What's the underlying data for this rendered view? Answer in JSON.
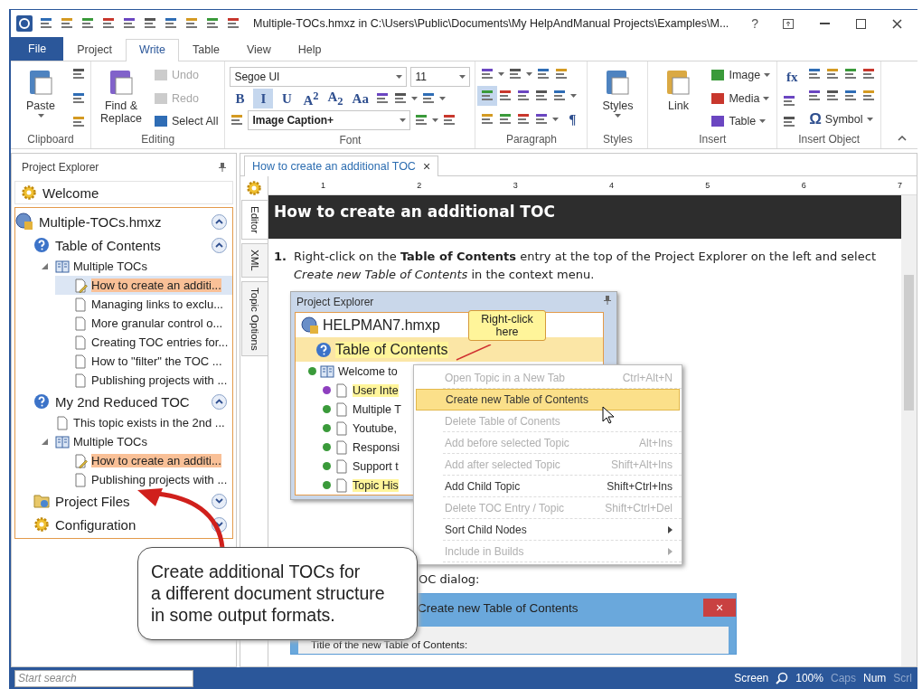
{
  "title_bar": {
    "title": "Multiple-TOCs.hmxz in C:\\Users\\Public\\Documents\\My HelpAndManual Projects\\Examples\\M...",
    "help": "?"
  },
  "ribbon_tabs": [
    {
      "label": "File",
      "kind": "file",
      "selected": false
    },
    {
      "label": "Project",
      "kind": "tab",
      "selected": false
    },
    {
      "label": "Write",
      "kind": "tab",
      "selected": true
    },
    {
      "label": "Table",
      "kind": "tab",
      "selected": false
    },
    {
      "label": "View",
      "kind": "tab",
      "selected": false
    },
    {
      "label": "Help",
      "kind": "tab",
      "selected": false
    }
  ],
  "ribbon_groups": [
    {
      "label": "Clipboard",
      "columns": [
        [
          [
            {
              "kind": "large",
              "label": "Paste",
              "dropdown": true
            }
          ]
        ],
        [
          [
            {
              "kind": "icon",
              "selected": false
            }
          ],
          [
            {
              "kind": "icon",
              "selected": false
            }
          ],
          [
            {
              "kind": "icon",
              "selected": false
            }
          ]
        ]
      ]
    },
    {
      "label": "Editing",
      "columns": [
        [
          [
            {
              "kind": "large",
              "label": "Find & Replace"
            }
          ]
        ],
        [
          [
            {
              "kind": "small",
              "label": "Undo",
              "disabled": true
            }
          ],
          [
            {
              "kind": "small",
              "label": "Redo",
              "disabled": true
            }
          ],
          [
            {
              "kind": "small",
              "label": "Select All",
              "disabled": false
            }
          ]
        ]
      ]
    },
    {
      "label": "Font",
      "columns": [
        [
          [
            {
              "kind": "combo",
              "value": "Segoe UI"
            },
            {
              "kind": "combo",
              "value": "11"
            }
          ],
          [
            {
              "kind": "glyph",
              "label": "B",
              "selected": false
            },
            {
              "kind": "glyph",
              "label": "I",
              "selected": true
            },
            {
              "kind": "glyph",
              "label": "U",
              "selected": false
            },
            {
              "kind": "glyph",
              "label": "A$^{2}$",
              "selected": false
            },
            {
              "kind": "glyph",
              "label": "A$_{2}$",
              "selected": false
            },
            {
              "kind": "glyph",
              "label": "Aa",
              "selected": false
            },
            {
              "kind": "icon",
              "selected": false
            },
            {
              "kind": "icon",
              "selected": false,
              "dropdown": true
            },
            {
              "kind": "icon",
              "selected": false,
              "dropdown": true
            }
          ],
          [
            {
              "kind": "icon",
              "selected": false
            },
            {
              "kind": "style-combo",
              "value": "Image Caption+"
            },
            {
              "kind": "icon",
              "selected": false,
              "dropdown": true
            },
            {
              "kind": "icon",
              "selected": false
            }
          ]
        ]
      ]
    },
    {
      "label": "Paragraph",
      "columns": [
        [
          [
            {
              "kind": "icon",
              "selected": false,
              "dropdown": true
            },
            {
              "kind": "icon",
              "selected": false,
              "dropdown": true
            },
            {
              "kind": "icon",
              "selected": false
            },
            {
              "kind": "icon",
              "selected": false
            }
          ],
          [
            {
              "kind": "icon",
              "selected": true
            },
            {
              "kind": "icon",
              "selected": false
            },
            {
              "kind": "icon",
              "selected": false
            },
            {
              "kind": "icon",
              "selected": false
            },
            {
              "kind": "icon",
              "selected": false,
              "dropdown": true
            }
          ],
          [
            {
              "kind": "icon",
              "selected": false
            },
            {
              "kind": "icon",
              "selected": false
            },
            {
              "kind": "icon",
              "selected": false
            },
            {
              "kind": "icon",
              "selected": false,
              "dropdown": true
            },
            {
              "kind": "glyph",
              "label": "¶",
              "selected": false
            }
          ]
        ]
      ]
    },
    {
      "label": "Styles",
      "columns": [
        [
          [
            {
              "kind": "large",
              "label": "Styles",
              "dropdown": true
            }
          ]
        ]
      ]
    },
    {
      "label": "Insert",
      "columns": [
        [
          [
            {
              "kind": "large",
              "label": "Link"
            }
          ]
        ],
        [
          [
            {
              "kind": "small",
              "label": "Image",
              "disabled": false,
              "dropdown": true
            }
          ],
          [
            {
              "kind": "small",
              "label": "Media",
              "disabled": false,
              "dropdown": true
            }
          ],
          [
            {
              "kind": "small",
              "label": "Table",
              "disabled": false,
              "dropdown": true
            }
          ]
        ]
      ]
    },
    {
      "label": "Insert Object",
      "columns": [
        [
          [
            {
              "kind": "glyph",
              "label": "fx",
              "selected": false
            }
          ],
          [
            {
              "kind": "icon",
              "selected": false
            }
          ],
          [
            {
              "kind": "icon",
              "selected": false
            }
          ]
        ],
        [
          [
            {
              "kind": "icon",
              "selected": false
            },
            {
              "kind": "icon",
              "selected": false
            },
            {
              "kind": "icon",
              "selected": false
            },
            {
              "kind": "icon",
              "selected": false
            }
          ],
          [
            {
              "kind": "icon",
              "selected": false
            },
            {
              "kind": "icon",
              "selected": false
            },
            {
              "kind": "icon",
              "selected": false
            },
            {
              "kind": "icon",
              "selected": false
            }
          ],
          [
            {
              "kind": "small",
              "label": "Symbol",
              "glyph": "Ω",
              "disabled": false,
              "dropdown": true
            }
          ]
        ]
      ]
    }
  ],
  "project_explorer": {
    "title": "Project Explorer",
    "welcome": "Welcome",
    "tree": [
      {
        "kind": "project",
        "label": "Multiple-TOCs.hmxz",
        "expanded": true,
        "children": [
          {
            "kind": "toc-section",
            "label": "Table of Contents",
            "expanded": true,
            "children": [
              {
                "kind": "book",
                "label": "Multiple TOCs",
                "expanded": true,
                "children": [
                  {
                    "kind": "topic",
                    "label": "How to create an additi...",
                    "selected": true,
                    "highlighted": true
                  },
                  {
                    "kind": "topic",
                    "label": "Managing links to exclu...",
                    "selected": false,
                    "highlighted": false
                  },
                  {
                    "kind": "topic",
                    "label": "More granular control o...",
                    "selected": false,
                    "highlighted": false
                  },
                  {
                    "kind": "topic",
                    "label": "Creating TOC entries for...",
                    "selected": false,
                    "highlighted": false
                  },
                  {
                    "kind": "topic",
                    "label": "How to \"filter\" the TOC ...",
                    "selected": false,
                    "highlighted": false
                  },
                  {
                    "kind": "topic",
                    "label": "Publishing projects with ...",
                    "selected": false,
                    "highlighted": false
                  }
                ]
              }
            ]
          },
          {
            "kind": "toc-section",
            "label": "My 2nd Reduced TOC",
            "expanded": true,
            "children": [
              {
                "kind": "topic",
                "label": "This topic exists in the 2nd ...",
                "selected": false,
                "highlighted": false
              },
              {
                "kind": "book",
                "label": "Multiple TOCs",
                "expanded": true,
                "children": [
                  {
                    "kind": "topic",
                    "label": "How to create an additi...",
                    "selected": false,
                    "highlighted": true
                  },
                  {
                    "kind": "topic",
                    "label": "Publishing projects with ...",
                    "selected": false,
                    "highlighted": false
                  }
                ]
              }
            ]
          },
          {
            "kind": "files-section",
            "label": "Project Files",
            "expanded": false
          },
          {
            "kind": "config-section",
            "label": "Configuration",
            "expanded": false
          }
        ]
      }
    ]
  },
  "editor": {
    "tab": {
      "label": "How to create an additional TOC",
      "close": "×"
    },
    "side_tabs": [
      {
        "label": "Editor",
        "selected": true
      },
      {
        "label": "XML",
        "selected": false
      },
      {
        "label": "Topic Options",
        "selected": false
      }
    ],
    "ruler_marks": [
      "1",
      "2",
      "3",
      "4",
      "5",
      "6",
      "7"
    ],
    "heading": "How to create an additional TOC",
    "steps": [
      {
        "number": "1.",
        "text": "Right-click on the **Table of Contents** entry at the top of the Project Explorer on the left and select *Create new Table of Contents* in the context menu."
      }
    ],
    "screenshot": {
      "title": "Project Explorer",
      "callout": "Right-click\nhere",
      "rows": [
        {
          "kind": "project",
          "label": "HELPMAN7.hmxp",
          "highlighted": false
        },
        {
          "kind": "section",
          "label": "Table of Contents",
          "highlighted": true
        },
        {
          "kind": "book",
          "label": "Welcome to",
          "highlighted": false,
          "color": "#3a9a3a"
        },
        {
          "kind": "topic",
          "label": "User Inte",
          "highlighted": true,
          "color": "#8e3fbf"
        },
        {
          "kind": "topic",
          "label": "Multiple T",
          "highlighted": false,
          "color": "#3a9a3a"
        },
        {
          "kind": "topic",
          "label": "Youtube,",
          "highlighted": false,
          "color": "#3a9a3a"
        },
        {
          "kind": "topic",
          "label": "Responsi",
          "highlighted": false,
          "color": "#3a9a3a"
        },
        {
          "kind": "topic",
          "label": "Support t",
          "highlighted": false,
          "color": "#3a9a3a"
        },
        {
          "kind": "topic",
          "label": "Topic His",
          "highlighted": true,
          "color": "#3a9a3a"
        }
      ],
      "context_menu": [
        {
          "label": "Open Topic in a New Tab",
          "shortcut": "Ctrl+Alt+N",
          "disabled": true,
          "selected": false
        },
        {
          "label": "Create new Table of Contents",
          "disabled": false,
          "selected": true
        },
        {
          "label": "Delete Table of Conents",
          "disabled": true,
          "selected": false
        },
        {
          "label": "Add before selected Topic",
          "shortcut": "Alt+Ins",
          "disabled": true,
          "selected": false
        },
        {
          "label": "Add after selected Topic",
          "shortcut": "Shift+Alt+Ins",
          "disabled": true,
          "selected": false
        },
        {
          "label": "Add Child Topic",
          "shortcut": "Shift+Ctrl+Ins",
          "disabled": false,
          "selected": false
        },
        {
          "label": "Delete TOC Entry / Topic",
          "shortcut": "Shift+Ctrl+Del",
          "disabled": true,
          "selected": false
        },
        {
          "label": "Sort Child Nodes",
          "submenu": true,
          "disabled": false,
          "selected": false
        },
        {
          "label": "Include in Builds",
          "submenu": true,
          "disabled": true,
          "selected": false
        }
      ]
    },
    "partial_text": "OC dialog:",
    "dialog": {
      "title": "Create new Table of Contents",
      "close": "×",
      "label": "Title of the new Table of Contents:"
    }
  },
  "callout": "Create additional TOCs for\na different document structure\nin some output formats.",
  "status_bar": {
    "search_placeholder": "Start search",
    "view": "Screen",
    "zoom": "100%",
    "indicators": [
      {
        "label": "Caps",
        "on": false
      },
      {
        "label": "Num",
        "on": true
      },
      {
        "label": "Scrl",
        "on": false
      }
    ]
  }
}
